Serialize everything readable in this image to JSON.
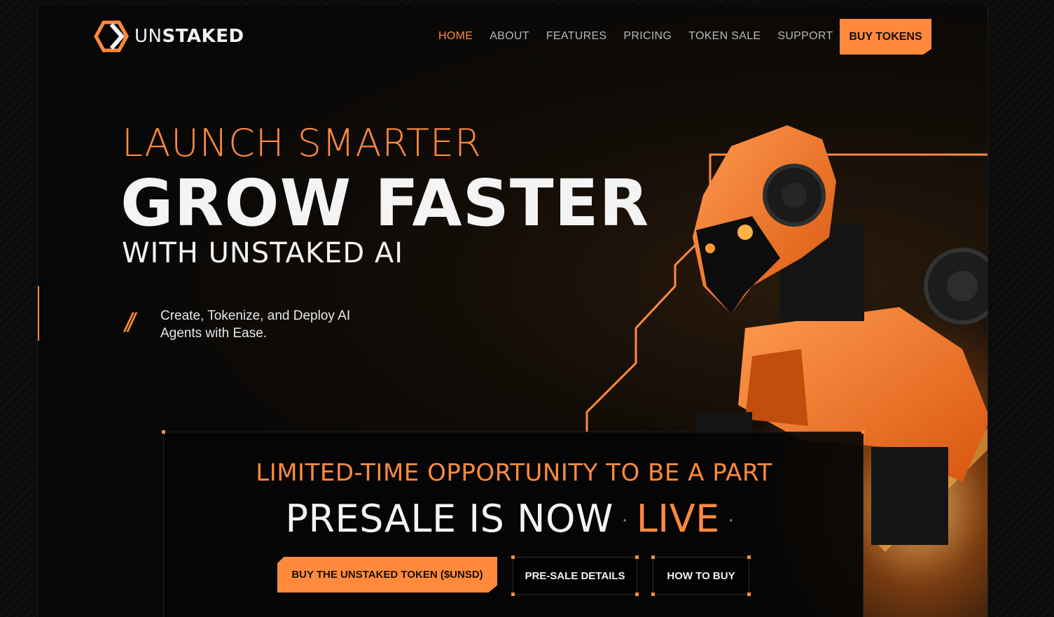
{
  "brand": {
    "name_light": "UN",
    "name_bold": "STAKED"
  },
  "nav": {
    "items": [
      {
        "label": "HOME",
        "active": true
      },
      {
        "label": "ABOUT"
      },
      {
        "label": "FEATURES"
      },
      {
        "label": "PRICING"
      },
      {
        "label": "TOKEN SALE"
      },
      {
        "label": "SUPPORT"
      }
    ],
    "cta": "BUY TOKENS"
  },
  "hero": {
    "line1": "LAUNCH SMARTER",
    "line2": "GROW FASTER",
    "line3": "WITH UNSTAKED AI",
    "slashes": "//",
    "tagline": "Create, Tokenize, and Deploy AI Agents with Ease."
  },
  "presale": {
    "eyebrow": "LIMITED-TIME OPPORTUNITY TO BE A PART",
    "headline": "PRESALE IS NOW",
    "dot": "·",
    "live": "LIVE",
    "buttons": {
      "buy": "BUY THE UNSTAKED TOKEN ($UNSD)",
      "details": "PRE-SALE DETAILS",
      "how": "HOW TO BUY"
    }
  },
  "colors": {
    "accent": "#ff8a3d",
    "background": "#070707",
    "text": "#f4f4f4"
  },
  "icons": [
    "hexagon-logo-icon",
    "robot-illustration"
  ]
}
